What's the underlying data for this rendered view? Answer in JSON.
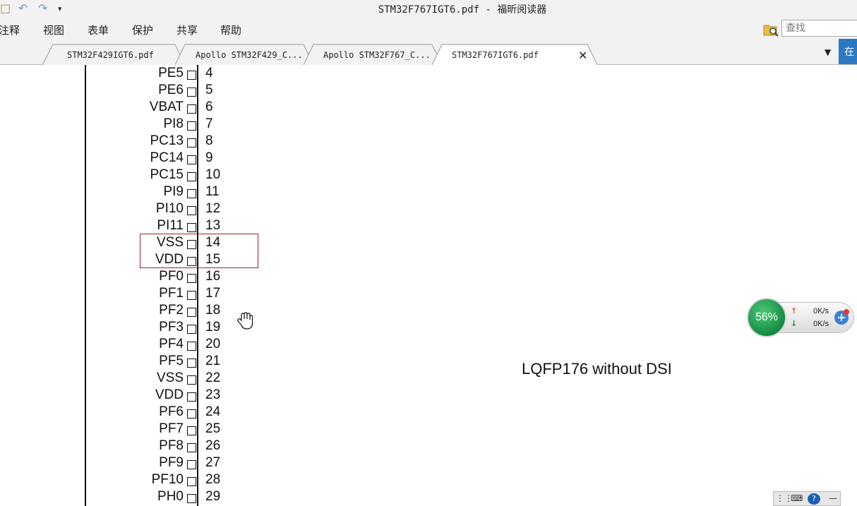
{
  "window": {
    "title": "STM32F767IGT6.pdf - 福昕阅读器"
  },
  "menu": {
    "items": [
      "注释",
      "视图",
      "表单",
      "保护",
      "共享",
      "帮助"
    ],
    "search_placeholder": "查找"
  },
  "tabs": [
    {
      "label": "STM32F429IGT6.pdf",
      "active": false
    },
    {
      "label": "Apollo STM32F429_C...",
      "active": false
    },
    {
      "label": "Apollo STM32F767_C...",
      "active": false
    },
    {
      "label": "STM32F767IGT6.pdf",
      "active": true
    }
  ],
  "side_button": "在",
  "document": {
    "package_label": "LQFP176 without DSI",
    "pins": [
      {
        "name": "PE5",
        "num": "4"
      },
      {
        "name": "PE6",
        "num": "5"
      },
      {
        "name": "VBAT",
        "num": "6"
      },
      {
        "name": "PI8",
        "num": "7"
      },
      {
        "name": "PC13",
        "num": "8"
      },
      {
        "name": "PC14",
        "num": "9"
      },
      {
        "name": "PC15",
        "num": "10"
      },
      {
        "name": "PI9",
        "num": "11"
      },
      {
        "name": "PI10",
        "num": "12"
      },
      {
        "name": "PI11",
        "num": "13"
      },
      {
        "name": "VSS",
        "num": "14"
      },
      {
        "name": "VDD",
        "num": "15"
      },
      {
        "name": "PF0",
        "num": "16"
      },
      {
        "name": "PF1",
        "num": "17"
      },
      {
        "name": "PF2",
        "num": "18"
      },
      {
        "name": "PF3",
        "num": "19"
      },
      {
        "name": "PF4",
        "num": "20"
      },
      {
        "name": "PF5",
        "num": "21"
      },
      {
        "name": "VSS",
        "num": "22"
      },
      {
        "name": "VDD",
        "num": "23"
      },
      {
        "name": "PF6",
        "num": "24"
      },
      {
        "name": "PF7",
        "num": "25"
      },
      {
        "name": "PF8",
        "num": "26"
      },
      {
        "name": "PF9",
        "num": "27"
      },
      {
        "name": "PF10",
        "num": "28"
      },
      {
        "name": "PH0",
        "num": "29"
      }
    ]
  },
  "net_widget": {
    "percent": "56%",
    "upload": "0K/s",
    "download": "0K/s",
    "colors": {
      "circle": "#158a43",
      "up_arrow": "#e05a1a",
      "down_arrow": "#1a8a3a"
    }
  },
  "colors": {
    "highlight_box": "#a3202b",
    "side_button": "#2b79c2"
  }
}
